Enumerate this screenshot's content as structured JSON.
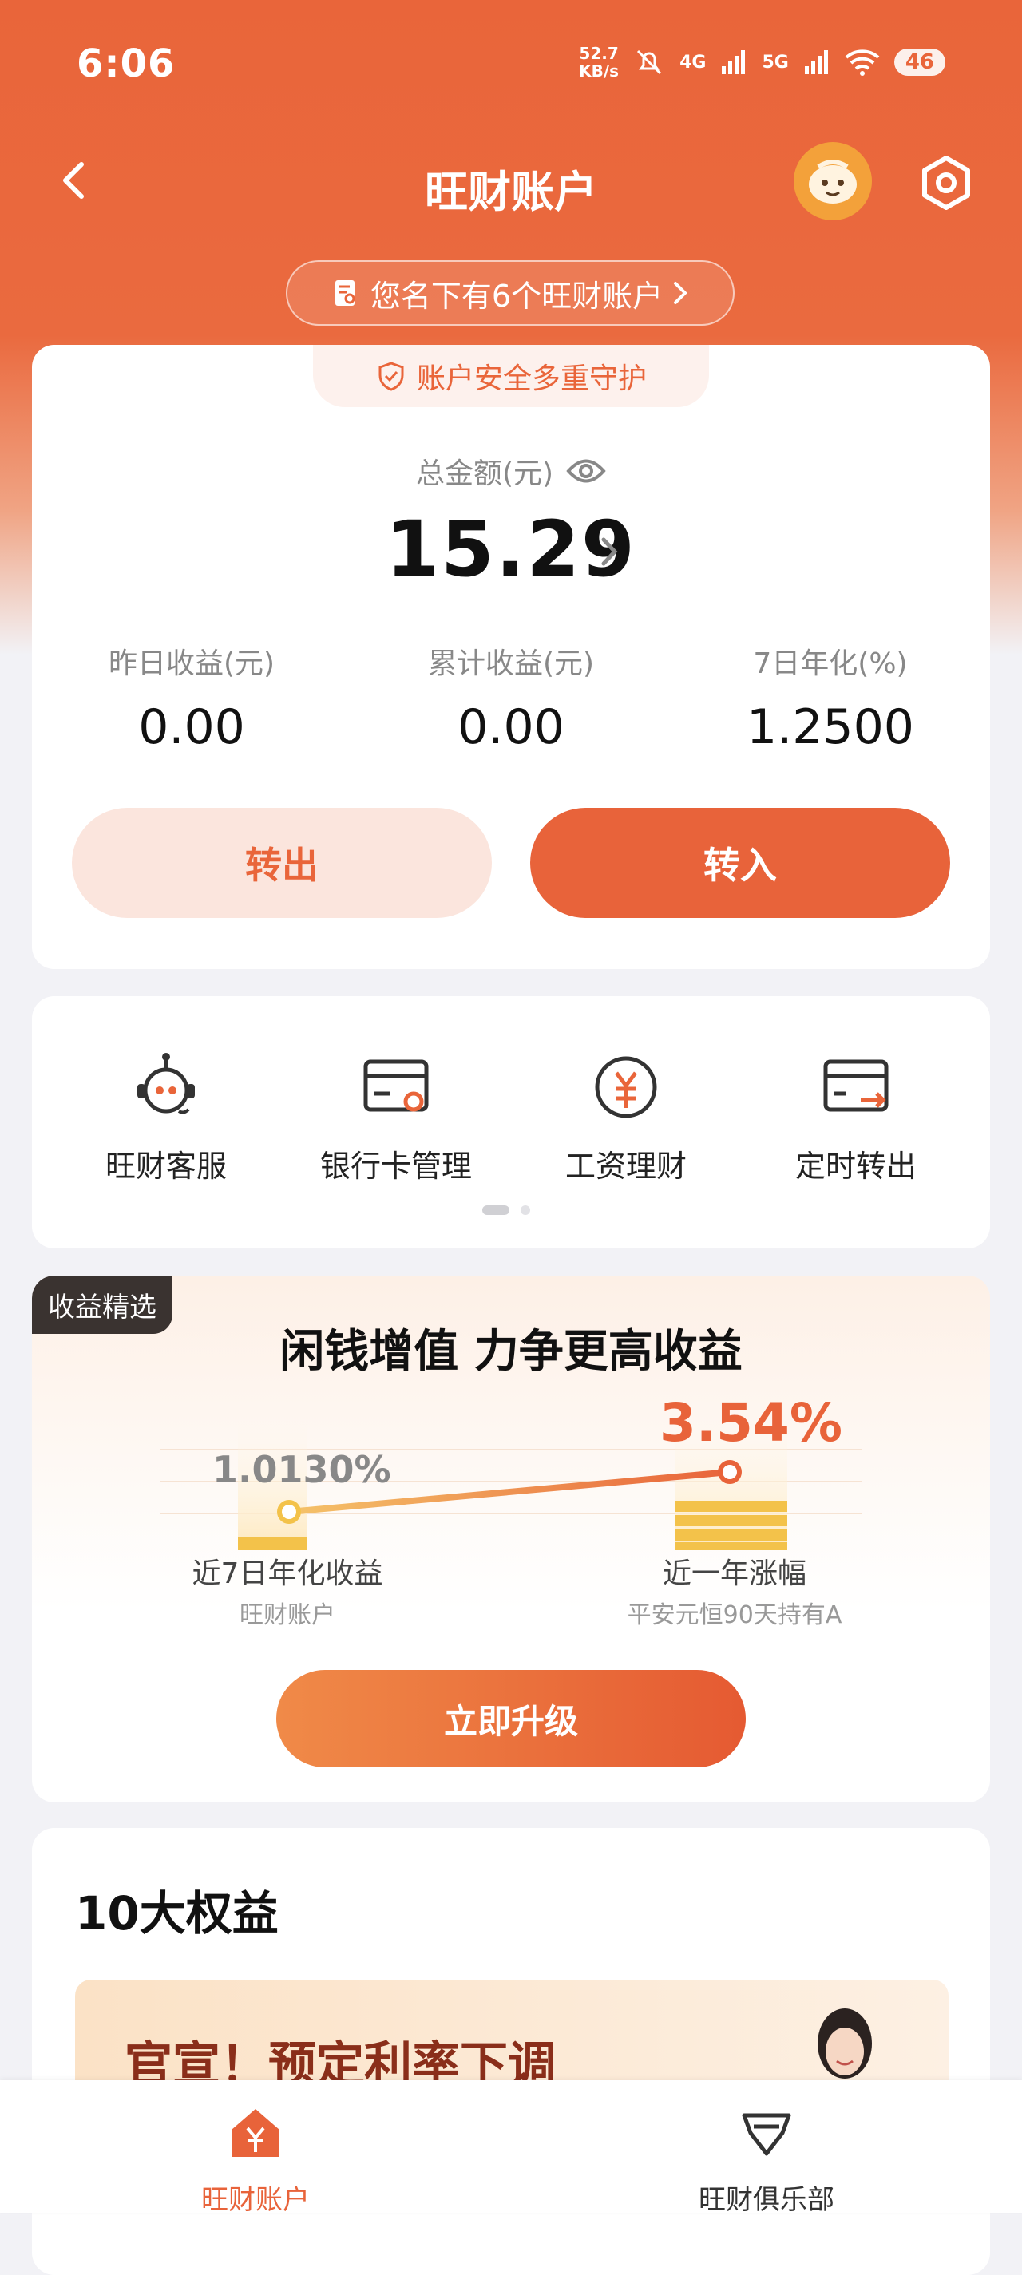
{
  "status_bar": {
    "time": "6:06",
    "speed": "52.7",
    "speed_unit": "KB/s",
    "net1": "4G",
    "net2": "5G",
    "battery": "46"
  },
  "header": {
    "title": "旺财账户"
  },
  "accounts_notice": "您名下有6个旺财账户",
  "security_tag": "账户安全多重守护",
  "total": {
    "label": "总金额(元)",
    "value": "15.29"
  },
  "stats": [
    {
      "label": "昨日收益(元)",
      "value": "0.00"
    },
    {
      "label": "累计收益(元)",
      "value": "0.00"
    },
    {
      "label": "7日年化(%)",
      "value": "1.2500"
    }
  ],
  "actions": {
    "transfer_out": "转出",
    "transfer_in": "转入"
  },
  "services": [
    {
      "label": "旺财客服",
      "icon": "robot-icon"
    },
    {
      "label": "银行卡管理",
      "icon": "bank-card-icon"
    },
    {
      "label": "工资理财",
      "icon": "yuan-coin-icon"
    },
    {
      "label": "定时转出",
      "icon": "card-transfer-icon"
    }
  ],
  "promo": {
    "tag": "收益精选",
    "title": "闲钱增值 力争更高收益",
    "left_rate": "1.0130%",
    "left_caption": "近7日年化收益",
    "left_sub": "旺财账户",
    "right_rate": "3.54%",
    "right_caption": "近一年涨幅",
    "right_sub": "平安元恒90天持有A",
    "button": "立即升级"
  },
  "benefits": {
    "title": "10大权益",
    "banner_text": "官宣！预定利率下调"
  },
  "tabbar": [
    {
      "label": "旺财账户",
      "active": true
    },
    {
      "label": "旺财俱乐部",
      "active": false
    }
  ],
  "colors": {
    "brand": "#e8633a",
    "brand_light": "#fbe5dd"
  }
}
